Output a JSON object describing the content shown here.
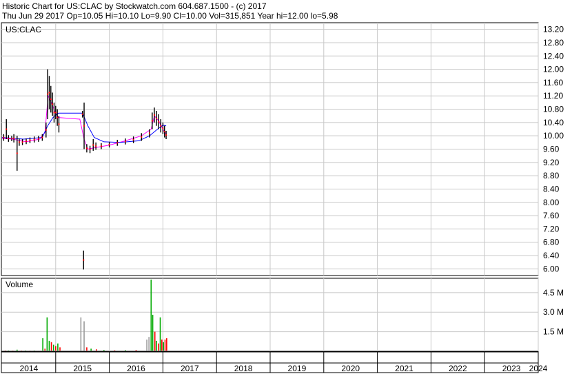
{
  "header": {
    "line1": "Historic Chart for US:CLAC by Stockwatch.com 604.687.1500 - (c) 2017",
    "line2": "Thu Jun 29 2017   Op=10.05   Hi=10.10   Lo=9.90   Cl=10.00   Vol=315,851   Year hi=12.00   lo=5.98"
  },
  "colors": {
    "price_bar": "#000000",
    "ma_fast": "#ff00ff",
    "ma_slow": "#0000ff",
    "close_mark": "#ff0000",
    "volume_up": "#00aa00",
    "volume_down": "#ff0000",
    "volume_flat": "#999999",
    "grid": "#c8c8c8"
  },
  "chart_data": [
    {
      "type": "line",
      "title": "US:CLAC",
      "ylim": [
        5.8,
        13.4
      ],
      "y_ticks": [
        "13.20",
        "12.80",
        "12.40",
        "12.00",
        "11.60",
        "11.20",
        "10.80",
        "10.40",
        "10.00",
        "9.60",
        "9.20",
        "8.80",
        "8.40",
        "8.00",
        "7.60",
        "7.20",
        "6.80",
        "6.40",
        "6.00"
      ],
      "x_ticks": [
        "2014",
        "2015",
        "2016",
        "2017",
        "2018",
        "2019",
        "2020",
        "2021",
        "2022",
        "2023",
        "2024"
      ],
      "xlim": [
        2014.0,
        2024.3
      ],
      "price_bars": [
        {
          "x": 2014.03,
          "low": 9.85,
          "high": 10.05
        },
        {
          "x": 2014.08,
          "low": 9.9,
          "high": 10.5
        },
        {
          "x": 2014.12,
          "low": 9.82,
          "high": 10.02
        },
        {
          "x": 2014.18,
          "low": 9.84,
          "high": 10.0
        },
        {
          "x": 2014.22,
          "low": 9.8,
          "high": 10.05
        },
        {
          "x": 2014.28,
          "low": 8.95,
          "high": 10.0
        },
        {
          "x": 2014.32,
          "low": 9.7,
          "high": 9.92
        },
        {
          "x": 2014.38,
          "low": 9.72,
          "high": 9.9
        },
        {
          "x": 2014.45,
          "low": 9.75,
          "high": 9.92
        },
        {
          "x": 2014.52,
          "low": 9.78,
          "high": 9.95
        },
        {
          "x": 2014.6,
          "low": 9.8,
          "high": 9.98
        },
        {
          "x": 2014.68,
          "low": 9.82,
          "high": 10.0
        },
        {
          "x": 2014.75,
          "low": 9.85,
          "high": 10.05
        },
        {
          "x": 2014.82,
          "low": 9.95,
          "high": 10.4
        },
        {
          "x": 2014.85,
          "low": 10.5,
          "high": 12.0
        },
        {
          "x": 2014.88,
          "low": 10.8,
          "high": 11.8
        },
        {
          "x": 2014.91,
          "low": 10.7,
          "high": 11.5
        },
        {
          "x": 2014.94,
          "low": 10.6,
          "high": 11.3
        },
        {
          "x": 2014.97,
          "low": 10.4,
          "high": 11.0
        },
        {
          "x": 2015.0,
          "low": 10.5,
          "high": 10.9
        },
        {
          "x": 2015.03,
          "low": 10.3,
          "high": 10.8
        },
        {
          "x": 2015.06,
          "low": 10.1,
          "high": 10.6
        },
        {
          "x": 2015.5,
          "low": 10.55,
          "high": 10.75
        },
        {
          "x": 2015.52,
          "low": 5.98,
          "high": 6.55
        },
        {
          "x": 2015.53,
          "low": 9.6,
          "high": 11.0
        },
        {
          "x": 2015.58,
          "low": 9.5,
          "high": 9.75
        },
        {
          "x": 2015.64,
          "low": 9.48,
          "high": 9.7
        },
        {
          "x": 2015.7,
          "low": 9.55,
          "high": 9.9
        },
        {
          "x": 2015.75,
          "low": 9.58,
          "high": 9.8
        },
        {
          "x": 2015.85,
          "low": 9.6,
          "high": 9.78
        },
        {
          "x": 2016.0,
          "low": 9.65,
          "high": 9.82
        },
        {
          "x": 2016.15,
          "low": 9.7,
          "high": 9.88
        },
        {
          "x": 2016.3,
          "low": 9.74,
          "high": 9.92
        },
        {
          "x": 2016.45,
          "low": 9.78,
          "high": 9.98
        },
        {
          "x": 2016.6,
          "low": 9.85,
          "high": 10.08
        },
        {
          "x": 2016.75,
          "low": 9.95,
          "high": 10.2
        },
        {
          "x": 2016.8,
          "low": 10.2,
          "high": 10.7
        },
        {
          "x": 2016.84,
          "low": 10.4,
          "high": 10.85
        },
        {
          "x": 2016.88,
          "low": 10.3,
          "high": 10.75
        },
        {
          "x": 2016.92,
          "low": 10.2,
          "high": 10.65
        },
        {
          "x": 2016.96,
          "low": 10.1,
          "high": 10.5
        },
        {
          "x": 2017.0,
          "low": 10.05,
          "high": 10.4
        },
        {
          "x": 2017.03,
          "low": 9.95,
          "high": 10.3
        },
        {
          "x": 2017.06,
          "low": 9.9,
          "high": 10.15
        }
      ],
      "series": [
        {
          "values": [
            [
              2014.0,
              9.92
            ],
            [
              2014.2,
              9.9
            ],
            [
              2014.45,
              9.82
            ],
            [
              2014.7,
              9.9
            ],
            [
              2014.8,
              10.1
            ],
            [
              2014.86,
              11.2
            ],
            [
              2014.92,
              11.0
            ],
            [
              2014.98,
              10.75
            ],
            [
              2015.05,
              10.55
            ],
            [
              2015.45,
              10.5
            ],
            [
              2015.53,
              9.9
            ],
            [
              2015.6,
              9.6
            ],
            [
              2015.75,
              9.65
            ],
            [
              2016.0,
              9.72
            ],
            [
              2016.3,
              9.85
            ],
            [
              2016.6,
              10.0
            ],
            [
              2016.78,
              10.2
            ],
            [
              2016.84,
              10.6
            ],
            [
              2016.92,
              10.45
            ],
            [
              2017.0,
              10.2
            ],
            [
              2017.06,
              10.05
            ]
          ]
        },
        {
          "values": [
            [
              2014.0,
              9.95
            ],
            [
              2014.4,
              9.9
            ],
            [
              2014.75,
              9.95
            ],
            [
              2014.85,
              10.3
            ],
            [
              2014.95,
              10.55
            ],
            [
              2015.05,
              10.68
            ],
            [
              2015.5,
              10.68
            ],
            [
              2015.6,
              10.3
            ],
            [
              2015.72,
              9.95
            ],
            [
              2015.9,
              9.82
            ],
            [
              2016.2,
              9.8
            ],
            [
              2016.55,
              9.85
            ],
            [
              2016.75,
              10.0
            ],
            [
              2016.9,
              10.2
            ],
            [
              2017.0,
              10.32
            ],
            [
              2017.06,
              10.3
            ]
          ]
        }
      ]
    },
    {
      "type": "bar",
      "title": "Volume",
      "ylim": [
        0,
        5600000
      ],
      "y_ticks": [
        "4.5 M",
        "3.0 M",
        "1.5 M"
      ],
      "bars": [
        {
          "x": 2014.06,
          "v": 30000,
          "c": "down"
        },
        {
          "x": 2014.12,
          "v": 25000,
          "c": "up"
        },
        {
          "x": 2014.2,
          "v": 40000,
          "c": "down"
        },
        {
          "x": 2014.28,
          "v": 120000,
          "c": "up"
        },
        {
          "x": 2014.36,
          "v": 35000,
          "c": "down"
        },
        {
          "x": 2014.44,
          "v": 30000,
          "c": "up"
        },
        {
          "x": 2014.52,
          "v": 45000,
          "c": "down"
        },
        {
          "x": 2014.6,
          "v": 30000,
          "c": "up"
        },
        {
          "x": 2014.68,
          "v": 50000,
          "c": "flat"
        },
        {
          "x": 2014.76,
          "v": 1000000,
          "c": "up"
        },
        {
          "x": 2014.8,
          "v": 200000,
          "c": "down"
        },
        {
          "x": 2014.84,
          "v": 2600000,
          "c": "up"
        },
        {
          "x": 2014.88,
          "v": 800000,
          "c": "up"
        },
        {
          "x": 2014.92,
          "v": 700000,
          "c": "down"
        },
        {
          "x": 2014.96,
          "v": 500000,
          "c": "up"
        },
        {
          "x": 2015.0,
          "v": 400000,
          "c": "down"
        },
        {
          "x": 2015.04,
          "v": 600000,
          "c": "up"
        },
        {
          "x": 2015.08,
          "v": 300000,
          "c": "down"
        },
        {
          "x": 2015.47,
          "v": 2600000,
          "c": "flat"
        },
        {
          "x": 2015.53,
          "v": 2300000,
          "c": "flat"
        },
        {
          "x": 2015.58,
          "v": 300000,
          "c": "down"
        },
        {
          "x": 2015.66,
          "v": 200000,
          "c": "up"
        },
        {
          "x": 2015.76,
          "v": 150000,
          "c": "down"
        },
        {
          "x": 2015.9,
          "v": 100000,
          "c": "up"
        },
        {
          "x": 2016.1,
          "v": 80000,
          "c": "down"
        },
        {
          "x": 2016.3,
          "v": 90000,
          "c": "up"
        },
        {
          "x": 2016.5,
          "v": 100000,
          "c": "down"
        },
        {
          "x": 2016.7,
          "v": 900000,
          "c": "flat"
        },
        {
          "x": 2016.74,
          "v": 1100000,
          "c": "flat"
        },
        {
          "x": 2016.78,
          "v": 5500000,
          "c": "up"
        },
        {
          "x": 2016.81,
          "v": 2800000,
          "c": "up"
        },
        {
          "x": 2016.85,
          "v": 1500000,
          "c": "down"
        },
        {
          "x": 2016.88,
          "v": 800000,
          "c": "up"
        },
        {
          "x": 2016.92,
          "v": 600000,
          "c": "down"
        },
        {
          "x": 2016.95,
          "v": 2600000,
          "c": "up"
        },
        {
          "x": 2016.98,
          "v": 900000,
          "c": "down"
        },
        {
          "x": 2017.01,
          "v": 700000,
          "c": "up"
        },
        {
          "x": 2017.04,
          "v": 900000,
          "c": "down"
        },
        {
          "x": 2017.07,
          "v": 1000000,
          "c": "down"
        }
      ]
    }
  ]
}
